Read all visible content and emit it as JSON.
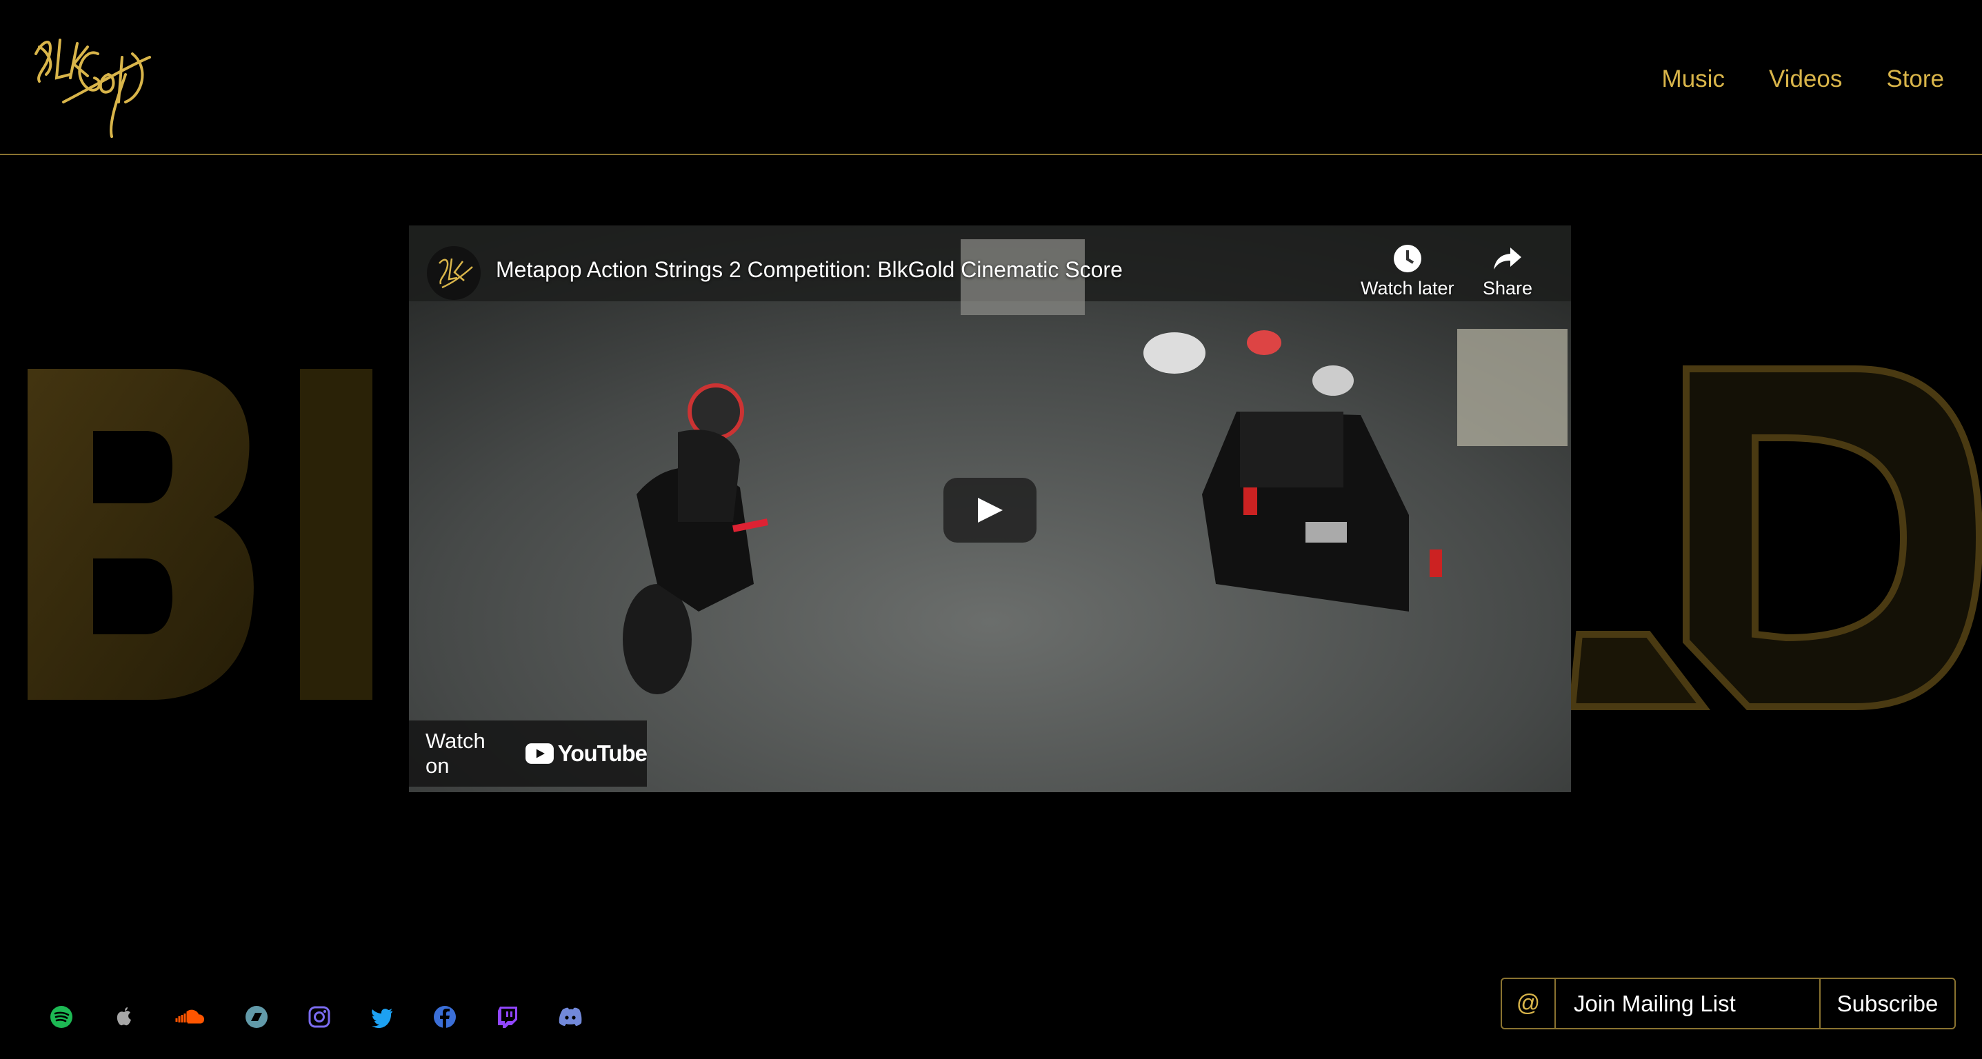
{
  "brand": {
    "logo_text": "BlkGold",
    "accent_color": "#d9b54a",
    "border_color": "#8a7330"
  },
  "nav": {
    "items": [
      {
        "label": "Music"
      },
      {
        "label": "Videos"
      },
      {
        "label": "Store"
      }
    ]
  },
  "video": {
    "title": "Metapop Action Strings 2 Competition: BlkGold Cinematic Score",
    "watch_later_label": "Watch later",
    "share_label": "Share",
    "watch_on_label": "Watch on",
    "youtube_label": "YouTube"
  },
  "socials": [
    {
      "icon": "spotify-icon",
      "color": "#1db954"
    },
    {
      "icon": "apple-music-icon",
      "color": "#a6a6a6"
    },
    {
      "icon": "soundcloud-icon",
      "color": "#ff5500"
    },
    {
      "icon": "bandcamp-icon",
      "color": "#629aa9"
    },
    {
      "icon": "instagram-icon",
      "color": "#7b6cf0"
    },
    {
      "icon": "twitter-icon",
      "color": "#1da1f2"
    },
    {
      "icon": "facebook-icon",
      "color": "#3b6fd8"
    },
    {
      "icon": "twitch-icon",
      "color": "#9146ff"
    },
    {
      "icon": "discord-icon",
      "color": "#7289da"
    }
  ],
  "mailing": {
    "at_symbol": "@",
    "placeholder": "Join Mailing List",
    "subscribe_label": "Subscribe"
  }
}
